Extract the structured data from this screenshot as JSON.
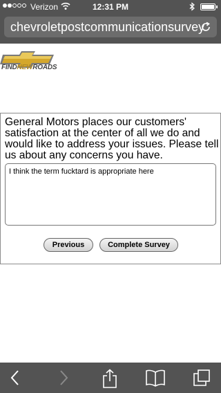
{
  "status": {
    "carrier": "Verizon",
    "time": "12:31 PM",
    "icons": [
      "signal-dots",
      "wifi-icon",
      "bluetooth-icon",
      "battery-icon"
    ]
  },
  "address_bar": {
    "url": "chevroletpostcommunicationsurvey",
    "icon": "reload-icon"
  },
  "logo": {
    "tagline_find": "FIND",
    "tagline_new": "NEW",
    "tagline_roads": "ROADS",
    "brand_color": "#b08a28"
  },
  "survey": {
    "prompt": "General Motors places our customers' satisfaction at the center of all we do and would like to address your issues. Please tell us about any concerns you have.",
    "comment_value": "I think the term fucktard is appropriate here",
    "previous_label": "Previous",
    "complete_label": "Complete Survey"
  },
  "toolbar": {
    "icons": [
      "back-icon",
      "forward-icon",
      "share-icon",
      "bookmarks-icon",
      "tabs-icon"
    ]
  },
  "colors": {
    "chrome": "#535353",
    "url_field": "#6c6c6c"
  }
}
